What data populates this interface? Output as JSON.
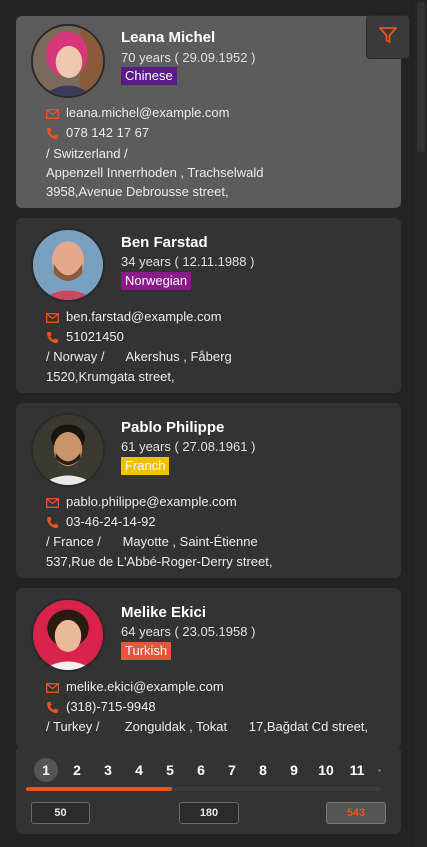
{
  "accent_color": "#e8561e",
  "filter": {
    "icon": "filter-icon"
  },
  "contacts": [
    {
      "name": "Leana Michel",
      "age_line": "70 years ( 29.09.1952 )",
      "language": "Chinese",
      "language_color": "#5a1a8a",
      "email": "leana.michel@example.com",
      "phone": "078 142 17 67",
      "address_lines": [
        "/ Switzerland /",
        "Appenzell Innerrhoden , Trachselwald",
        "3958,Avenue Debrousse street,"
      ],
      "selected": true
    },
    {
      "name": "Ben Farstad",
      "age_line": "34 years ( 12.11.1988 )",
      "language": "Norwegian",
      "language_color": "#8a1a8a",
      "email": "ben.farstad@example.com",
      "phone": "51021450",
      "address_lines": [
        "/ Norway /      Akershus , Fåberg",
        "1520,Krumgata street,"
      ],
      "selected": false
    },
    {
      "name": "Pablo Philippe",
      "age_line": "61 years ( 27.08.1961 )",
      "language": "Franch",
      "language_color": "#f2c200",
      "email": "pablo.philippe@example.com",
      "phone": "03-46-24-14-92",
      "address_lines": [
        "/ France /      Mayotte , Saint-Étienne",
        "537,Rue de L'Abbé-Roger-Derry street,"
      ],
      "selected": false
    },
    {
      "name": "Melike Ekici",
      "age_line": "64 years ( 23.05.1958 )",
      "language": "Turkish",
      "language_color": "#e8563a",
      "email": "melike.ekici@example.com",
      "phone": "(318)-715-9948",
      "address_lines": [
        "/ Turkey /       Zonguldak , Tokat      17,Bağdat Cd street,"
      ],
      "selected": false
    }
  ],
  "pagination": {
    "pages": [
      "1",
      "2",
      "3",
      "4",
      "5",
      "6",
      "7",
      "8",
      "9",
      "10",
      "11"
    ],
    "active_page": "1",
    "progress_fraction": 0.41,
    "page_sizes": [
      "50",
      "180",
      "543"
    ],
    "active_page_size": "543"
  }
}
